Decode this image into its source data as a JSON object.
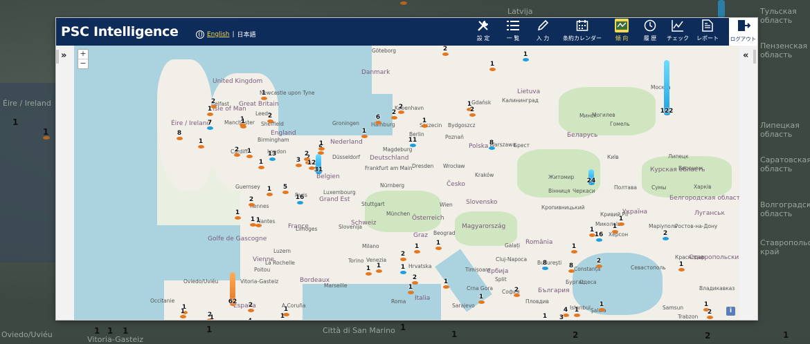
{
  "app": {
    "title": "PSC Intelligence",
    "lang_en": "English",
    "lang_sep": "|",
    "lang_ja": "日本語"
  },
  "nav": [
    {
      "label": "設 定",
      "icon": "tools-icon"
    },
    {
      "label": "一 覧",
      "icon": "list-icon"
    },
    {
      "label": "入 力",
      "icon": "pencil-icon"
    },
    {
      "label": "条約カレンダー",
      "icon": "calendar-icon"
    },
    {
      "label": "傾 向",
      "icon": "map-trend-icon",
      "active": true
    },
    {
      "label": "履 歴",
      "icon": "clock-icon"
    },
    {
      "label": "チェック",
      "icon": "chart-line-icon"
    },
    {
      "label": "レポート",
      "icon": "document-icon"
    }
  ],
  "logout_label": "ログアウト",
  "map_controls": {
    "expand": "»",
    "collapse": "«",
    "zoom_in": "+",
    "zoom_out": "−",
    "info": "i"
  },
  "map_labels": [
    "Göteborg",
    "Danmark",
    "København",
    "United Kingdom",
    "Newcastle upon Tyne",
    "Belfast",
    "Isle of Man",
    "Great Britain",
    "Leeds",
    "Manchester",
    "Sheffield",
    "Éire / Ireland",
    "England",
    "Birmingham",
    "Cardiff",
    "London",
    "Groningen",
    "Hamburg",
    "Nederland",
    "Szczecin",
    "Bydgoszcz",
    "Gdańsk",
    "Калининград",
    "Lietuva",
    "Berlin",
    "Poznań",
    "Polska",
    "Warszawa",
    "Magdeburg",
    "Düsseldorf",
    "Deutschland",
    "Dresden",
    "Wrocław",
    "Frankfurt am Main",
    "Belgien",
    "Luxembourg",
    "Česko",
    "Kraków",
    "Nürnberg",
    "Stuttgart",
    "Slovensko",
    "München",
    "Österreich",
    "Wien",
    "Rennes",
    "Nantes",
    "France",
    "Guernsey",
    "Paris",
    "Grand Est",
    "Schweiz",
    "Magyarország",
    "Golfe de Gascogne",
    "Milano",
    "Venezia",
    "Torino",
    "Hrvatska",
    "România",
    "Bucureşti",
    "Marseille",
    "Italia",
    "Roma",
    "Oviedo/Uviéu",
    "Vitoria-Gasteiz",
    "España",
    "Crna Gora",
    "Србија",
    "София",
    "Пловдив",
    "България",
    "Constanța",
    "Одеса",
    "Україна",
    "Київ",
    "Житомир",
    "Вінниця",
    "Полтава",
    "Черкаси",
    "Кропивницький",
    "Кривий Ріг",
    "Миколаїв",
    "Херсон",
    "Маріуполь",
    "Ростов-на-Дону",
    "Севастополь",
    "Краснодар",
    "Ставропольский край",
    "Беларусь",
    "Минск",
    "Гомель",
    "Могилев",
    "Брест",
    "Москва",
    "Липецк",
    "Воронеж",
    "Курская область",
    "Белгородская область",
    "Сумы",
    "Харків",
    "Луганськ",
    "Samsun",
    "Trabzon",
    "Владикавказ",
    "Şalala",
    "Istanbul",
    "Бургас",
    "Galați",
    "Cluj-Napoca",
    "Timișoara",
    "Sarajevo",
    "Split",
    "Beograd",
    "Graz",
    "Slovenija",
    "Luzern",
    "Limoges",
    "Vienne",
    "Poitou",
    "La Rochelle",
    "Bordeaux",
    "Occitanie",
    "A Coruña",
    "La Rioja"
  ],
  "markers": [
    {
      "n": "2",
      "c": "o"
    },
    {
      "n": "1",
      "c": "o"
    },
    {
      "n": "1",
      "c": "b"
    },
    {
      "n": "122",
      "c": "b",
      "bar": true
    },
    {
      "n": "1",
      "c": "o"
    },
    {
      "n": "2",
      "c": "o"
    },
    {
      "n": "1",
      "c": "o"
    },
    {
      "n": "1",
      "c": "o"
    },
    {
      "n": "2",
      "c": "o"
    },
    {
      "n": "7",
      "c": "b"
    },
    {
      "n": "1",
      "c": "o"
    },
    {
      "n": "8",
      "c": "o"
    },
    {
      "n": "1",
      "c": "o"
    },
    {
      "n": "2",
      "c": "o"
    },
    {
      "n": "1",
      "c": "o"
    },
    {
      "n": "13",
      "c": "b"
    },
    {
      "n": "1",
      "c": "o"
    },
    {
      "n": "2",
      "c": "o"
    },
    {
      "n": "2",
      "c": "o"
    },
    {
      "n": "6",
      "c": "o"
    },
    {
      "n": "1",
      "c": "o"
    },
    {
      "n": "1",
      "c": "o"
    },
    {
      "n": "2",
      "c": "o"
    },
    {
      "n": "1",
      "c": "o"
    },
    {
      "n": "11",
      "c": "b"
    },
    {
      "n": "8",
      "c": "b"
    },
    {
      "n": "24",
      "c": "b",
      "bar": true
    },
    {
      "n": "2",
      "c": "o"
    },
    {
      "n": "5",
      "c": "o"
    },
    {
      "n": "3",
      "c": "o"
    },
    {
      "n": "2",
      "c": "o"
    },
    {
      "n": "12",
      "c": "o"
    },
    {
      "n": "31",
      "c": "b",
      "bar": true
    },
    {
      "n": "1",
      "c": "o"
    },
    {
      "n": "5",
      "c": "o"
    },
    {
      "n": "16",
      "c": "b"
    },
    {
      "n": "1",
      "c": "o"
    },
    {
      "n": "2",
      "c": "o"
    },
    {
      "n": "1",
      "c": "o"
    },
    {
      "n": "1",
      "c": "o"
    },
    {
      "n": "1",
      "c": "o"
    },
    {
      "n": "1",
      "c": "o"
    },
    {
      "n": "1",
      "c": "o"
    },
    {
      "n": "2",
      "c": "o"
    },
    {
      "n": "1",
      "c": "b"
    },
    {
      "n": "1",
      "c": "o"
    },
    {
      "n": "1",
      "c": "o"
    },
    {
      "n": "2",
      "c": "o"
    },
    {
      "n": "1",
      "c": "o"
    },
    {
      "n": "1",
      "c": "o"
    },
    {
      "n": "8",
      "c": "b"
    },
    {
      "n": "8",
      "c": "o"
    },
    {
      "n": "1",
      "c": "o"
    },
    {
      "n": "2",
      "c": "o"
    },
    {
      "n": "1",
      "c": "o"
    },
    {
      "n": "1",
      "c": "o"
    },
    {
      "n": "16",
      "c": "b"
    },
    {
      "n": "1",
      "c": "o"
    },
    {
      "n": "2",
      "c": "b"
    },
    {
      "n": "1",
      "c": "o"
    },
    {
      "n": "2",
      "c": "o"
    },
    {
      "n": "1",
      "c": "o"
    },
    {
      "n": "1",
      "c": "o"
    },
    {
      "n": "4",
      "c": "o"
    },
    {
      "n": "3",
      "c": "o"
    },
    {
      "n": "1",
      "c": "o"
    },
    {
      "n": "1",
      "c": "o"
    },
    {
      "n": "1",
      "c": "o"
    },
    {
      "n": "4",
      "c": "o"
    },
    {
      "n": "62",
      "c": "o",
      "bar": true
    },
    {
      "n": "2",
      "c": "o"
    },
    {
      "n": "1",
      "c": "o"
    },
    {
      "n": "1",
      "c": "o"
    },
    {
      "n": "2",
      "c": "o"
    },
    {
      "n": "1",
      "c": "o"
    },
    {
      "n": "1",
      "c": "o"
    },
    {
      "n": "1",
      "c": "o"
    },
    {
      "n": "2",
      "c": "o"
    }
  ],
  "background": {
    "labels": [
      "Éire / Ireland",
      "Latvija",
      "Oviedo/Uviéu",
      "Vitoria-Gasteiz",
      "Città di San Marino",
      "Ставропольский край",
      "Тульская область",
      "Липецкая область",
      "Пензенская область",
      "Саратовская область",
      "Волгоградская область"
    ],
    "numbers": [
      "1",
      "1",
      "1",
      "1",
      "1",
      "1",
      "1",
      "1",
      "2",
      "1",
      "2"
    ]
  },
  "colors": {
    "nav_bg": "#0d2c59",
    "active": "#f3d94b",
    "marker_orange": "#e5781f",
    "marker_blue": "#1e9fde"
  }
}
